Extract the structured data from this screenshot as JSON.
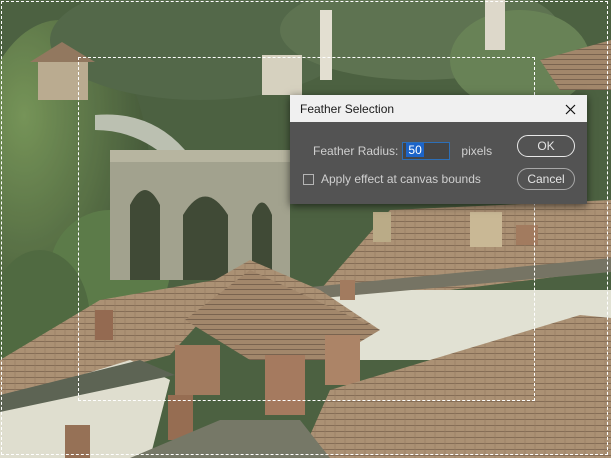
{
  "dialog": {
    "title": "Feather Selection",
    "feather_radius_label": "Feather Radius:",
    "feather_radius_value": "50",
    "unit": "pixels",
    "apply_canvas_bounds_label": "Apply effect at canvas bounds",
    "apply_canvas_bounds_checked": false,
    "ok_label": "OK",
    "cancel_label": "Cancel",
    "close_icon": "close-icon"
  },
  "colors": {
    "dialog_bg": "#535353",
    "titlebar_bg": "#f0f0f0",
    "input_highlight": "#1c64c8",
    "input_border": "#2d6fb7"
  }
}
